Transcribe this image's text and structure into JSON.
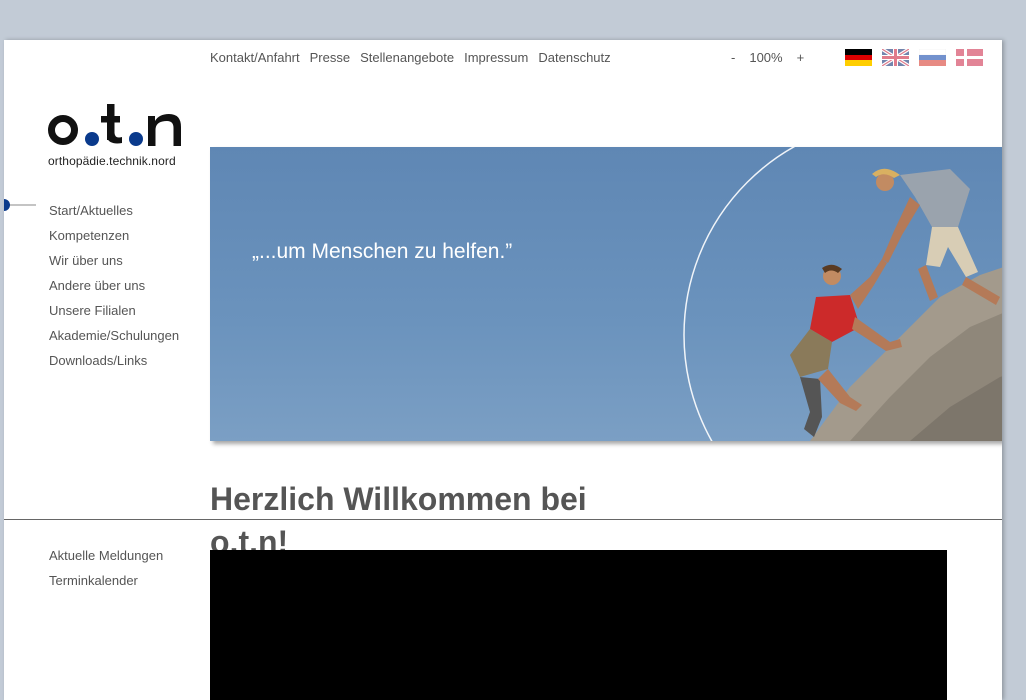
{
  "top_nav": [
    "Kontakt/Anfahrt",
    "Presse",
    "Stellenangebote",
    "Impressum",
    "Datenschutz"
  ],
  "zoom": {
    "minus": "-",
    "level": "100%",
    "plus": "+"
  },
  "languages": [
    "german-flag-icon",
    "uk-flag-icon",
    "russian-flag-icon",
    "danish-flag-icon"
  ],
  "logo": {
    "main": "o.t.n",
    "subtitle": "orthopädie.technik.nord",
    "dot_color": "#0a3a8c"
  },
  "side_nav": [
    "Start/Aktuelles",
    "Kompetenzen",
    "Wir über uns",
    "Andere über uns",
    "Unsere Filialen",
    "Akademie/Schulungen",
    "Downloads/Links"
  ],
  "side_nav_active": "Start/Aktuelles",
  "hero": {
    "quote": "„...um Menschen zu helfen.”"
  },
  "welcome": {
    "title": "Herzlich Willkommen bei o.t.n!"
  },
  "sub_nav": [
    "Aktuelle Meldungen",
    "Terminkalender"
  ],
  "colors": {
    "page_bg": "#c2cbd6",
    "accent": "#0a3a8c",
    "hero_sky": "#6b93bd"
  }
}
